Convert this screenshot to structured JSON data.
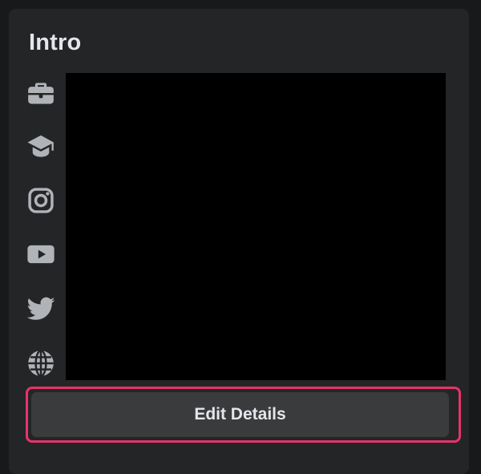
{
  "intro": {
    "title": "Intro",
    "icons": [
      "briefcase-icon",
      "graduation-cap-icon",
      "instagram-icon",
      "youtube-icon",
      "twitter-icon",
      "globe-icon"
    ],
    "edit_button_label": "Edit Details"
  },
  "colors": {
    "page_background": "#18191a",
    "card_background": "#242526",
    "icon": "#b0b3b8",
    "button_background": "#3a3b3c",
    "text": "#e4e6eb",
    "highlight_border": "#e8336b",
    "redacted": "#000000"
  }
}
